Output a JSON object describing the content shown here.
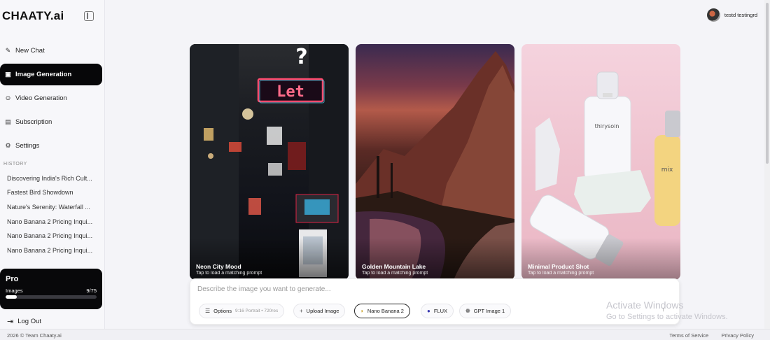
{
  "brand": "CHAATY.ai",
  "user": {
    "name": "testd testingrd"
  },
  "nav": [
    {
      "label": "New Chat",
      "icon": "edit-icon",
      "active": false
    },
    {
      "label": "Image Generation",
      "icon": "image-icon",
      "active": true
    },
    {
      "label": "Video Generation",
      "icon": "play-icon",
      "active": false
    },
    {
      "label": "Subscription",
      "icon": "receipt-icon",
      "active": false
    },
    {
      "label": "Settings",
      "icon": "gear-icon",
      "active": false
    }
  ],
  "history": {
    "label": "HISTORY",
    "items": [
      "Discovering India's Rich Cult...",
      "Fastest Bird Showdown",
      "Nature's Serenity: Waterfall ...",
      "Nano Banana 2 Pricing Inqui...",
      "Nano Banana 2 Pricing Inqui...",
      "Nano Banana 2 Pricing Inqui..."
    ]
  },
  "plan": {
    "name": "Pro",
    "label": "Images",
    "used": 9,
    "total": 75,
    "count_text": "9/75",
    "fraction": 0.12
  },
  "logout": "Log Out",
  "cards": [
    {
      "title": "Neon City Mood",
      "subtitle": "Tap to load a matching prompt",
      "sign": "Let"
    },
    {
      "title": "Golden Mountain Lake",
      "subtitle": "Tap to load a matching prompt"
    },
    {
      "title": "Minimal Product Shot",
      "subtitle": "Tap to load a matching prompt",
      "label_1": "thirysoin",
      "label_2": "mix"
    }
  ],
  "prompt": {
    "placeholder": "Describe the image you want to generate...",
    "options_label": "Options",
    "options_detail": "9:16 Portrait • 720res",
    "upload_label": "Upload Image",
    "models": [
      "Nano Banana 2",
      "FLUX",
      "GPT Image 1"
    ],
    "selected_model": "Nano Banana 2"
  },
  "watermark": {
    "line1": "Activate Windows",
    "line2": "Go to Settings to activate Windows."
  },
  "footer": {
    "copyright": "2026 © Team Chaaty.ai",
    "links": [
      "Terms of Service",
      "Privacy Policy"
    ]
  }
}
